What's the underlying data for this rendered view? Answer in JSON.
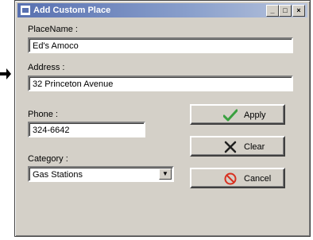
{
  "window": {
    "title": "Add Custom Place",
    "minimize_glyph": "_",
    "maximize_glyph": "□",
    "close_glyph": "×"
  },
  "form": {
    "place_name_label": "PlaceName :",
    "place_name_value": "Ed's Amoco",
    "address_label": "Address :",
    "address_value": "32 Princeton Avenue",
    "phone_label": "Phone :",
    "phone_value": "324-6642",
    "category_label": "Category :",
    "category_value": "Gas Stations"
  },
  "buttons": {
    "apply_label": "Apply",
    "clear_label": "Clear",
    "cancel_label": "Cancel"
  },
  "icons": {
    "apply": "checkmark-icon",
    "clear": "x-cross-icon",
    "cancel": "no-entry-icon",
    "title": "window-app-icon",
    "pointer": "arrow-pointer-icon"
  },
  "colors": {
    "dialog_bg": "#d4d0c8",
    "titlebar_start": "#5870b0",
    "apply_icon": "#3aa040",
    "cancel_icon": "#d83020"
  }
}
